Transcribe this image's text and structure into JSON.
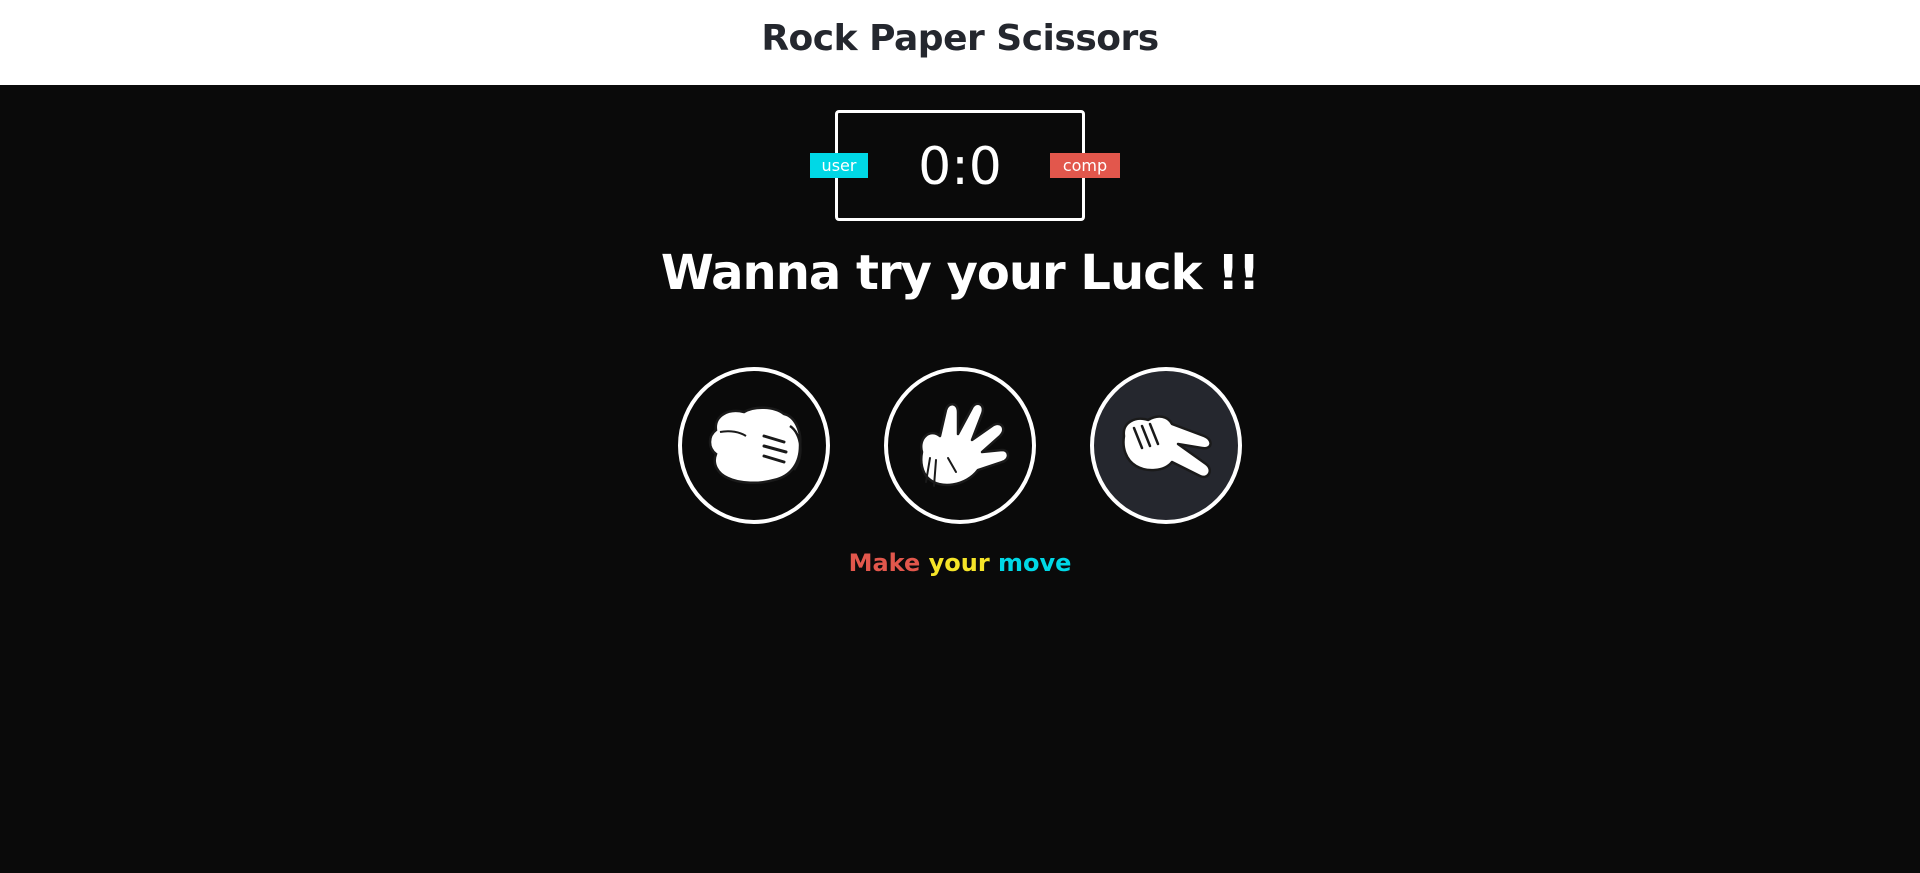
{
  "header": {
    "title": "Rock Paper Scissors"
  },
  "scoreboard": {
    "user_label": "user",
    "comp_label": "comp",
    "score": "0:0",
    "user_score": 0,
    "comp_score": 0
  },
  "tagline": "Wanna try your Luck !!",
  "choices": [
    {
      "name": "rock",
      "icon": "rock-hand-icon"
    },
    {
      "name": "paper",
      "icon": "paper-hand-icon"
    },
    {
      "name": "scissors",
      "icon": "scissors-hand-icon"
    }
  ],
  "action_message": {
    "word1": "Make",
    "word2": "your",
    "word3": "move"
  },
  "colors": {
    "user": "#00d8e6",
    "comp": "#e2574c",
    "accent_yellow": "#f5e428",
    "background": "#0a0a0a",
    "header_background": "#ffffff",
    "title_text": "#24272e"
  }
}
